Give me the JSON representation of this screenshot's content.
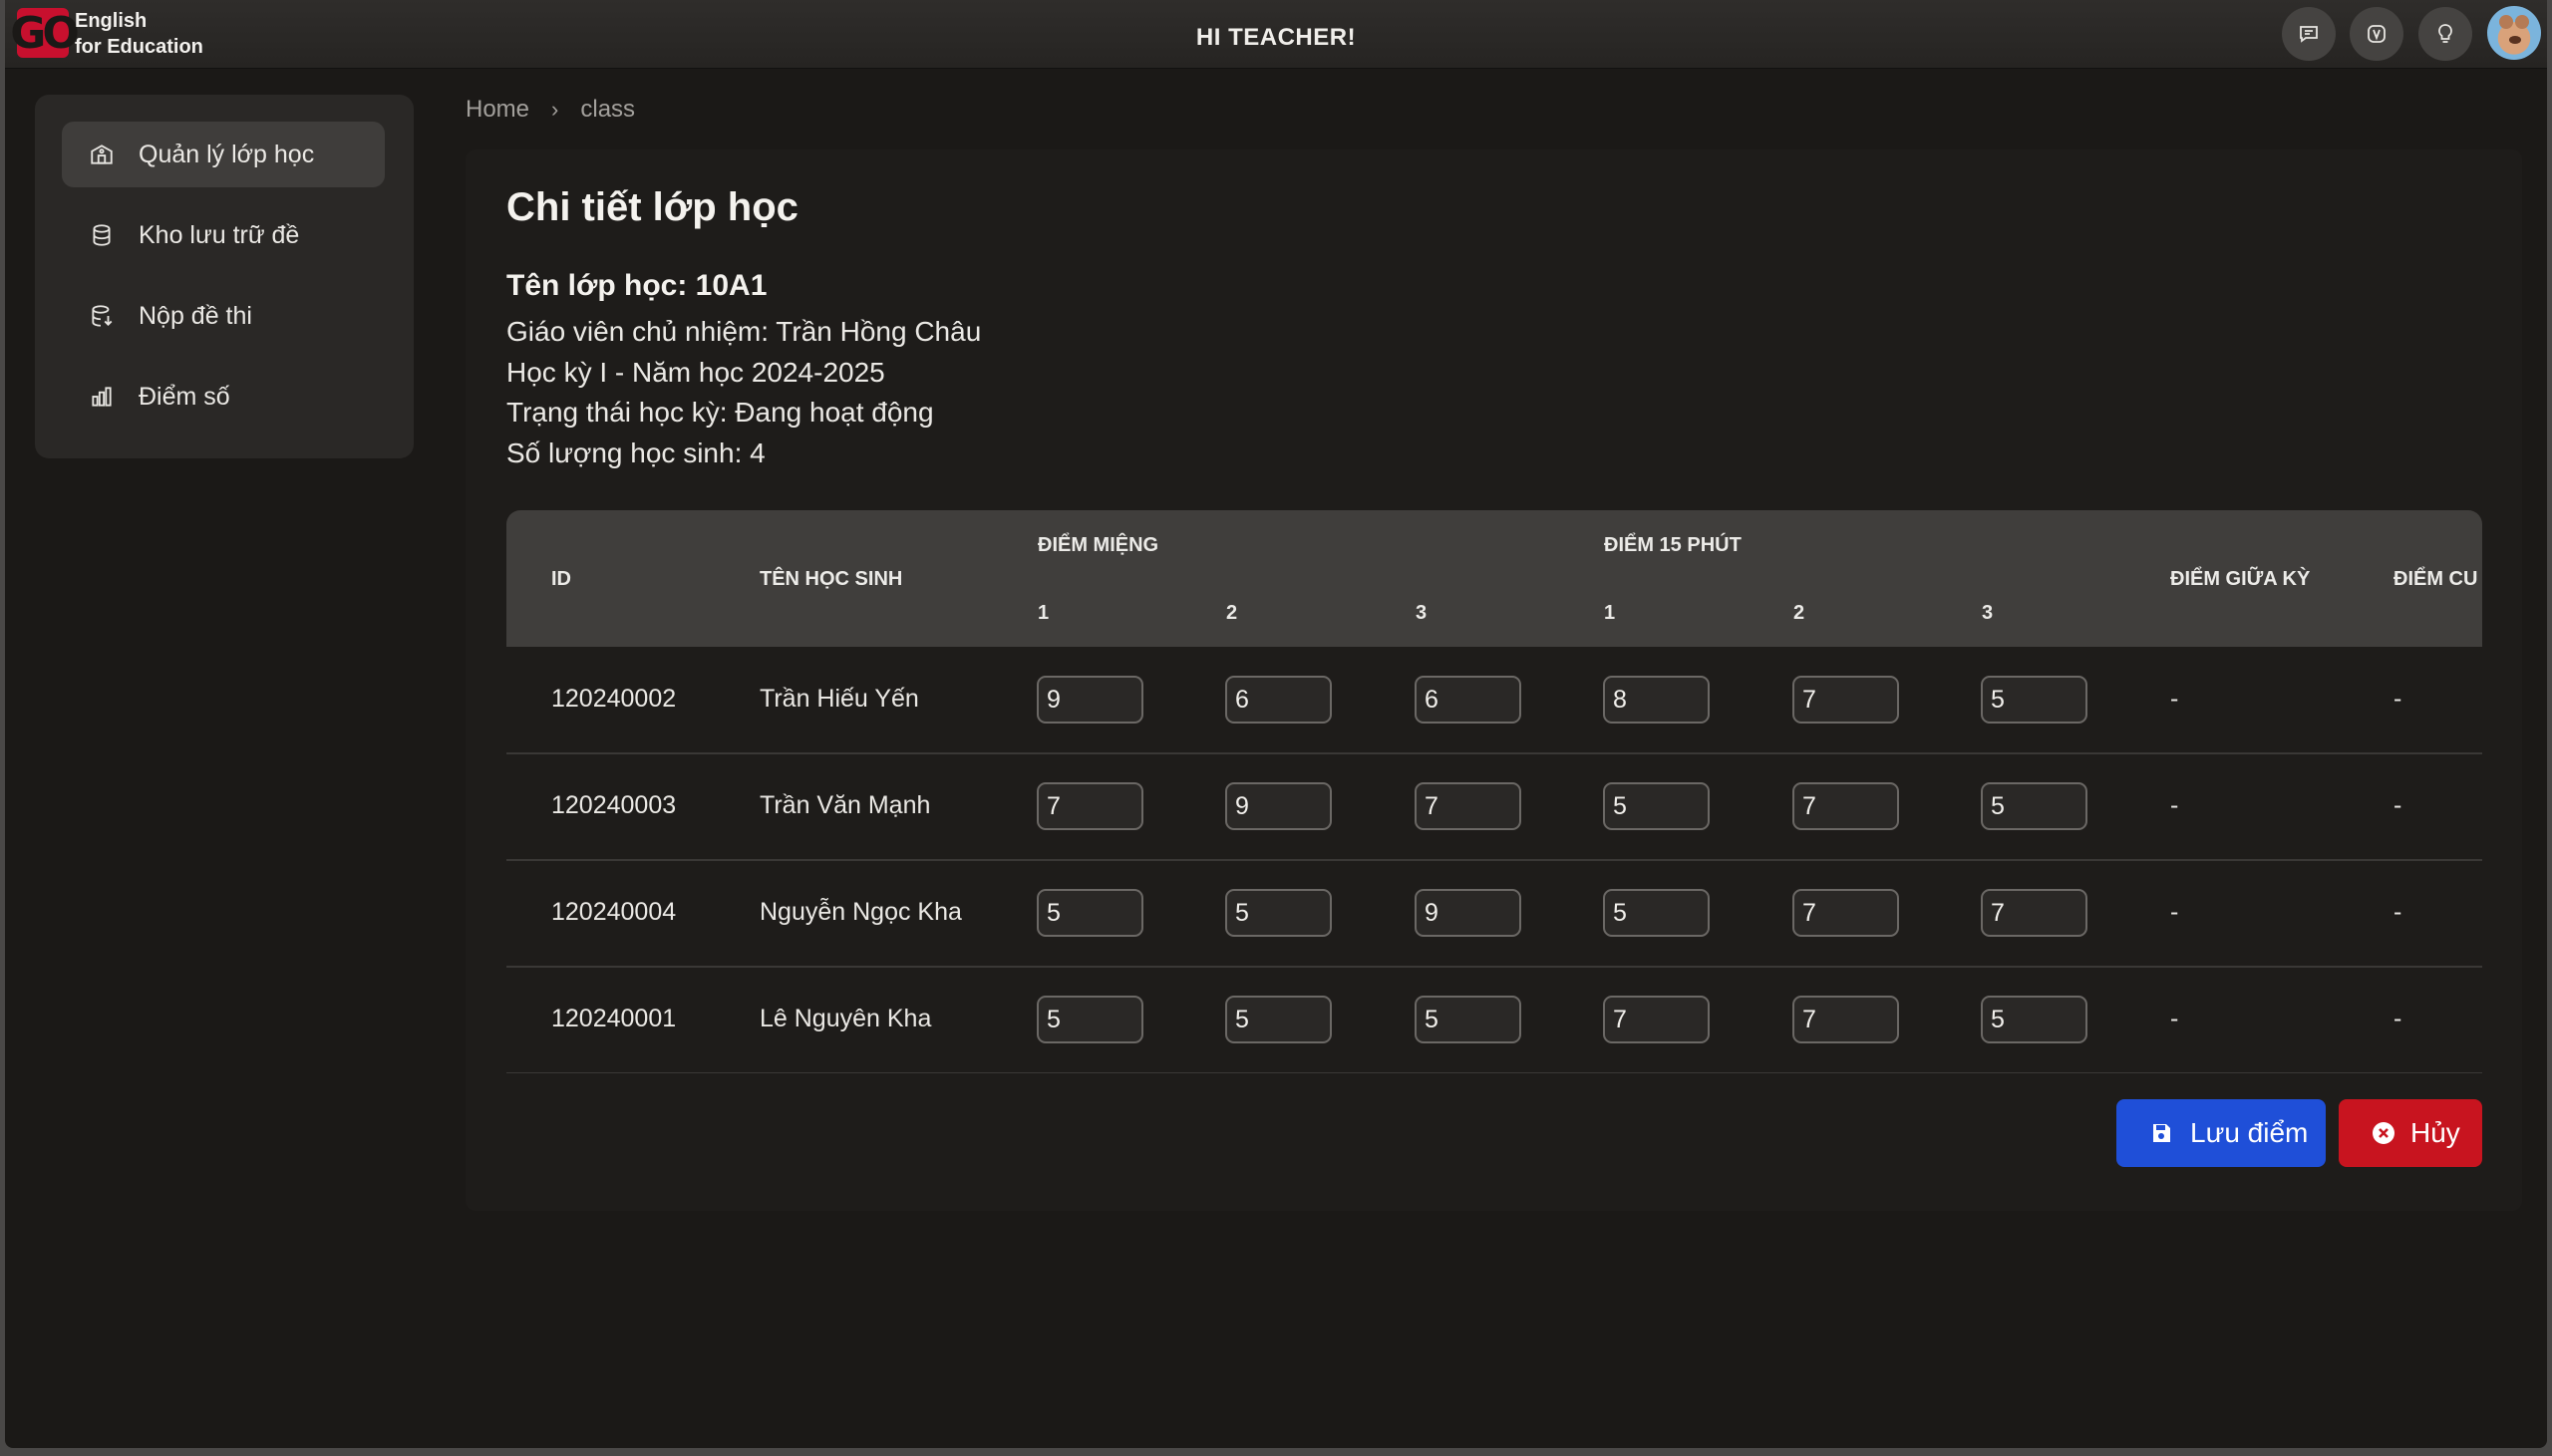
{
  "header": {
    "logo_mark": "GO",
    "logo_line1": "English",
    "logo_line2": "for Education",
    "greeting": "HI TEACHER!",
    "icons": [
      "chat-icon",
      "v-badge-icon",
      "lightbulb-icon"
    ]
  },
  "sidebar": {
    "items": [
      {
        "label": "Quản lý lớp học",
        "icon": "school-icon",
        "active": true
      },
      {
        "label": "Kho lưu trữ đề",
        "icon": "database-icon",
        "active": false
      },
      {
        "label": "Nộp đề thi",
        "icon": "database-upload-icon",
        "active": false
      },
      {
        "label": "Điểm số",
        "icon": "bar-chart-icon",
        "active": false
      }
    ]
  },
  "breadcrumb": {
    "home": "Home",
    "current": "class"
  },
  "page": {
    "title": "Chi tiết lớp học",
    "class_name": "Tên lớp học: 10A1",
    "teacher": "Giáo viên chủ nhiệm: Trần Hồng Châu",
    "term": "Học kỳ I - Năm học 2024-2025",
    "status": "Trạng thái học kỳ: Đang hoạt động",
    "student_count": "Số lượng học sinh: 4"
  },
  "table": {
    "headers": {
      "id": "ID",
      "name": "TÊN HỌC SINH",
      "oral": "ĐIỂM MIỆNG",
      "quiz15": "ĐIỂM 15 PHÚT",
      "midterm": "ĐIỂM GIỮA KỲ",
      "final": "ĐIỂM CU",
      "sub": [
        "1",
        "2",
        "3",
        "1",
        "2",
        "3"
      ]
    },
    "rows": [
      {
        "id": "120240002",
        "name": "Trần Hiếu Yến",
        "scores": [
          "9",
          "6",
          "6",
          "8",
          "7",
          "5"
        ],
        "midterm": "-",
        "final": "-"
      },
      {
        "id": "120240003",
        "name": "Trần Văn Mạnh",
        "scores": [
          "7",
          "9",
          "7",
          "5",
          "7",
          "5"
        ],
        "midterm": "-",
        "final": "-"
      },
      {
        "id": "120240004",
        "name": "Nguyễn Ngọc Kha",
        "scores": [
          "5",
          "5",
          "9",
          "5",
          "7",
          "7"
        ],
        "midterm": "-",
        "final": "-"
      },
      {
        "id": "120240001",
        "name": "Lê Nguyên Kha",
        "scores": [
          "5",
          "5",
          "5",
          "7",
          "7",
          "5"
        ],
        "midterm": "-",
        "final": "-"
      }
    ]
  },
  "actions": {
    "save": "Lưu điểm",
    "cancel": "Hủy"
  },
  "colors": {
    "save": "#1f4fd8",
    "cancel": "#c8141f",
    "logo": "#c8102e"
  }
}
